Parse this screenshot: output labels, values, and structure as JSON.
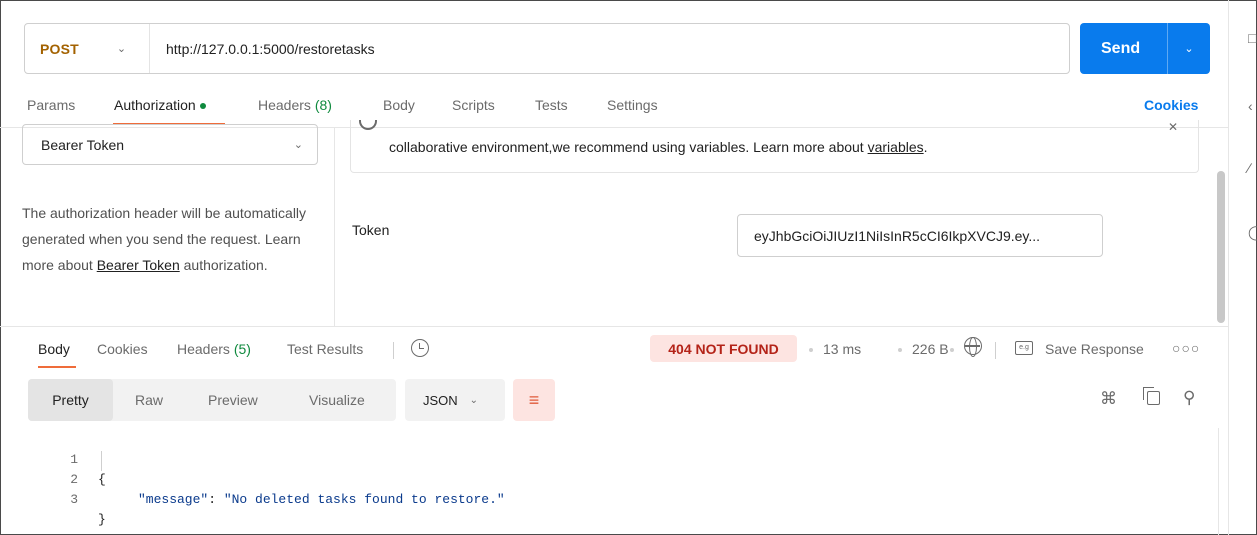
{
  "request": {
    "method": "POST",
    "url": "http://127.0.0.1:5000/restoretasks",
    "send_label": "Send"
  },
  "request_tabs": {
    "params": "Params",
    "authorization": "Authorization",
    "headers": "Headers",
    "headers_count": "(8)",
    "body": "Body",
    "scripts": "Scripts",
    "tests": "Tests",
    "settings": "Settings",
    "cookies": "Cookies"
  },
  "auth": {
    "type": "Bearer Token",
    "description_prefix": "The authorization header will be automatically generated when you send the request. Learn more about ",
    "description_link": "Bearer Token",
    "description_suffix": " authorization.",
    "notice_prefix": "collaborative environment,we recommend using variables. Learn more about ",
    "notice_link": "variables",
    "notice_suffix": ".",
    "token_label": "Token",
    "token_value": "eyJhbGciOiJIUzI1NiIsInR5cCI6IkpXVCJ9.ey..."
  },
  "response_tabs": {
    "body": "Body",
    "cookies": "Cookies",
    "headers": "Headers",
    "headers_count": "(5)",
    "test_results": "Test Results"
  },
  "response_meta": {
    "status": "404 NOT FOUND",
    "time": "13 ms",
    "size": "226 B",
    "save_response": "Save Response"
  },
  "response_view": {
    "pretty": "Pretty",
    "raw": "Raw",
    "preview": "Preview",
    "visualize": "Visualize",
    "format": "JSON"
  },
  "response_body": {
    "lines": [
      {
        "num": "1",
        "open": "{"
      },
      {
        "num": "2",
        "key": "\"message\"",
        "sep": ": ",
        "value": "\"No deleted tasks found to restore.\""
      },
      {
        "num": "3",
        "close": "}"
      }
    ]
  },
  "colors": {
    "send": "#097bed",
    "method": "#a36200",
    "accent": "#ef6c3a",
    "status_bg": "#fde4e1",
    "status_text": "#b42318",
    "count": "#0f8a3e"
  }
}
